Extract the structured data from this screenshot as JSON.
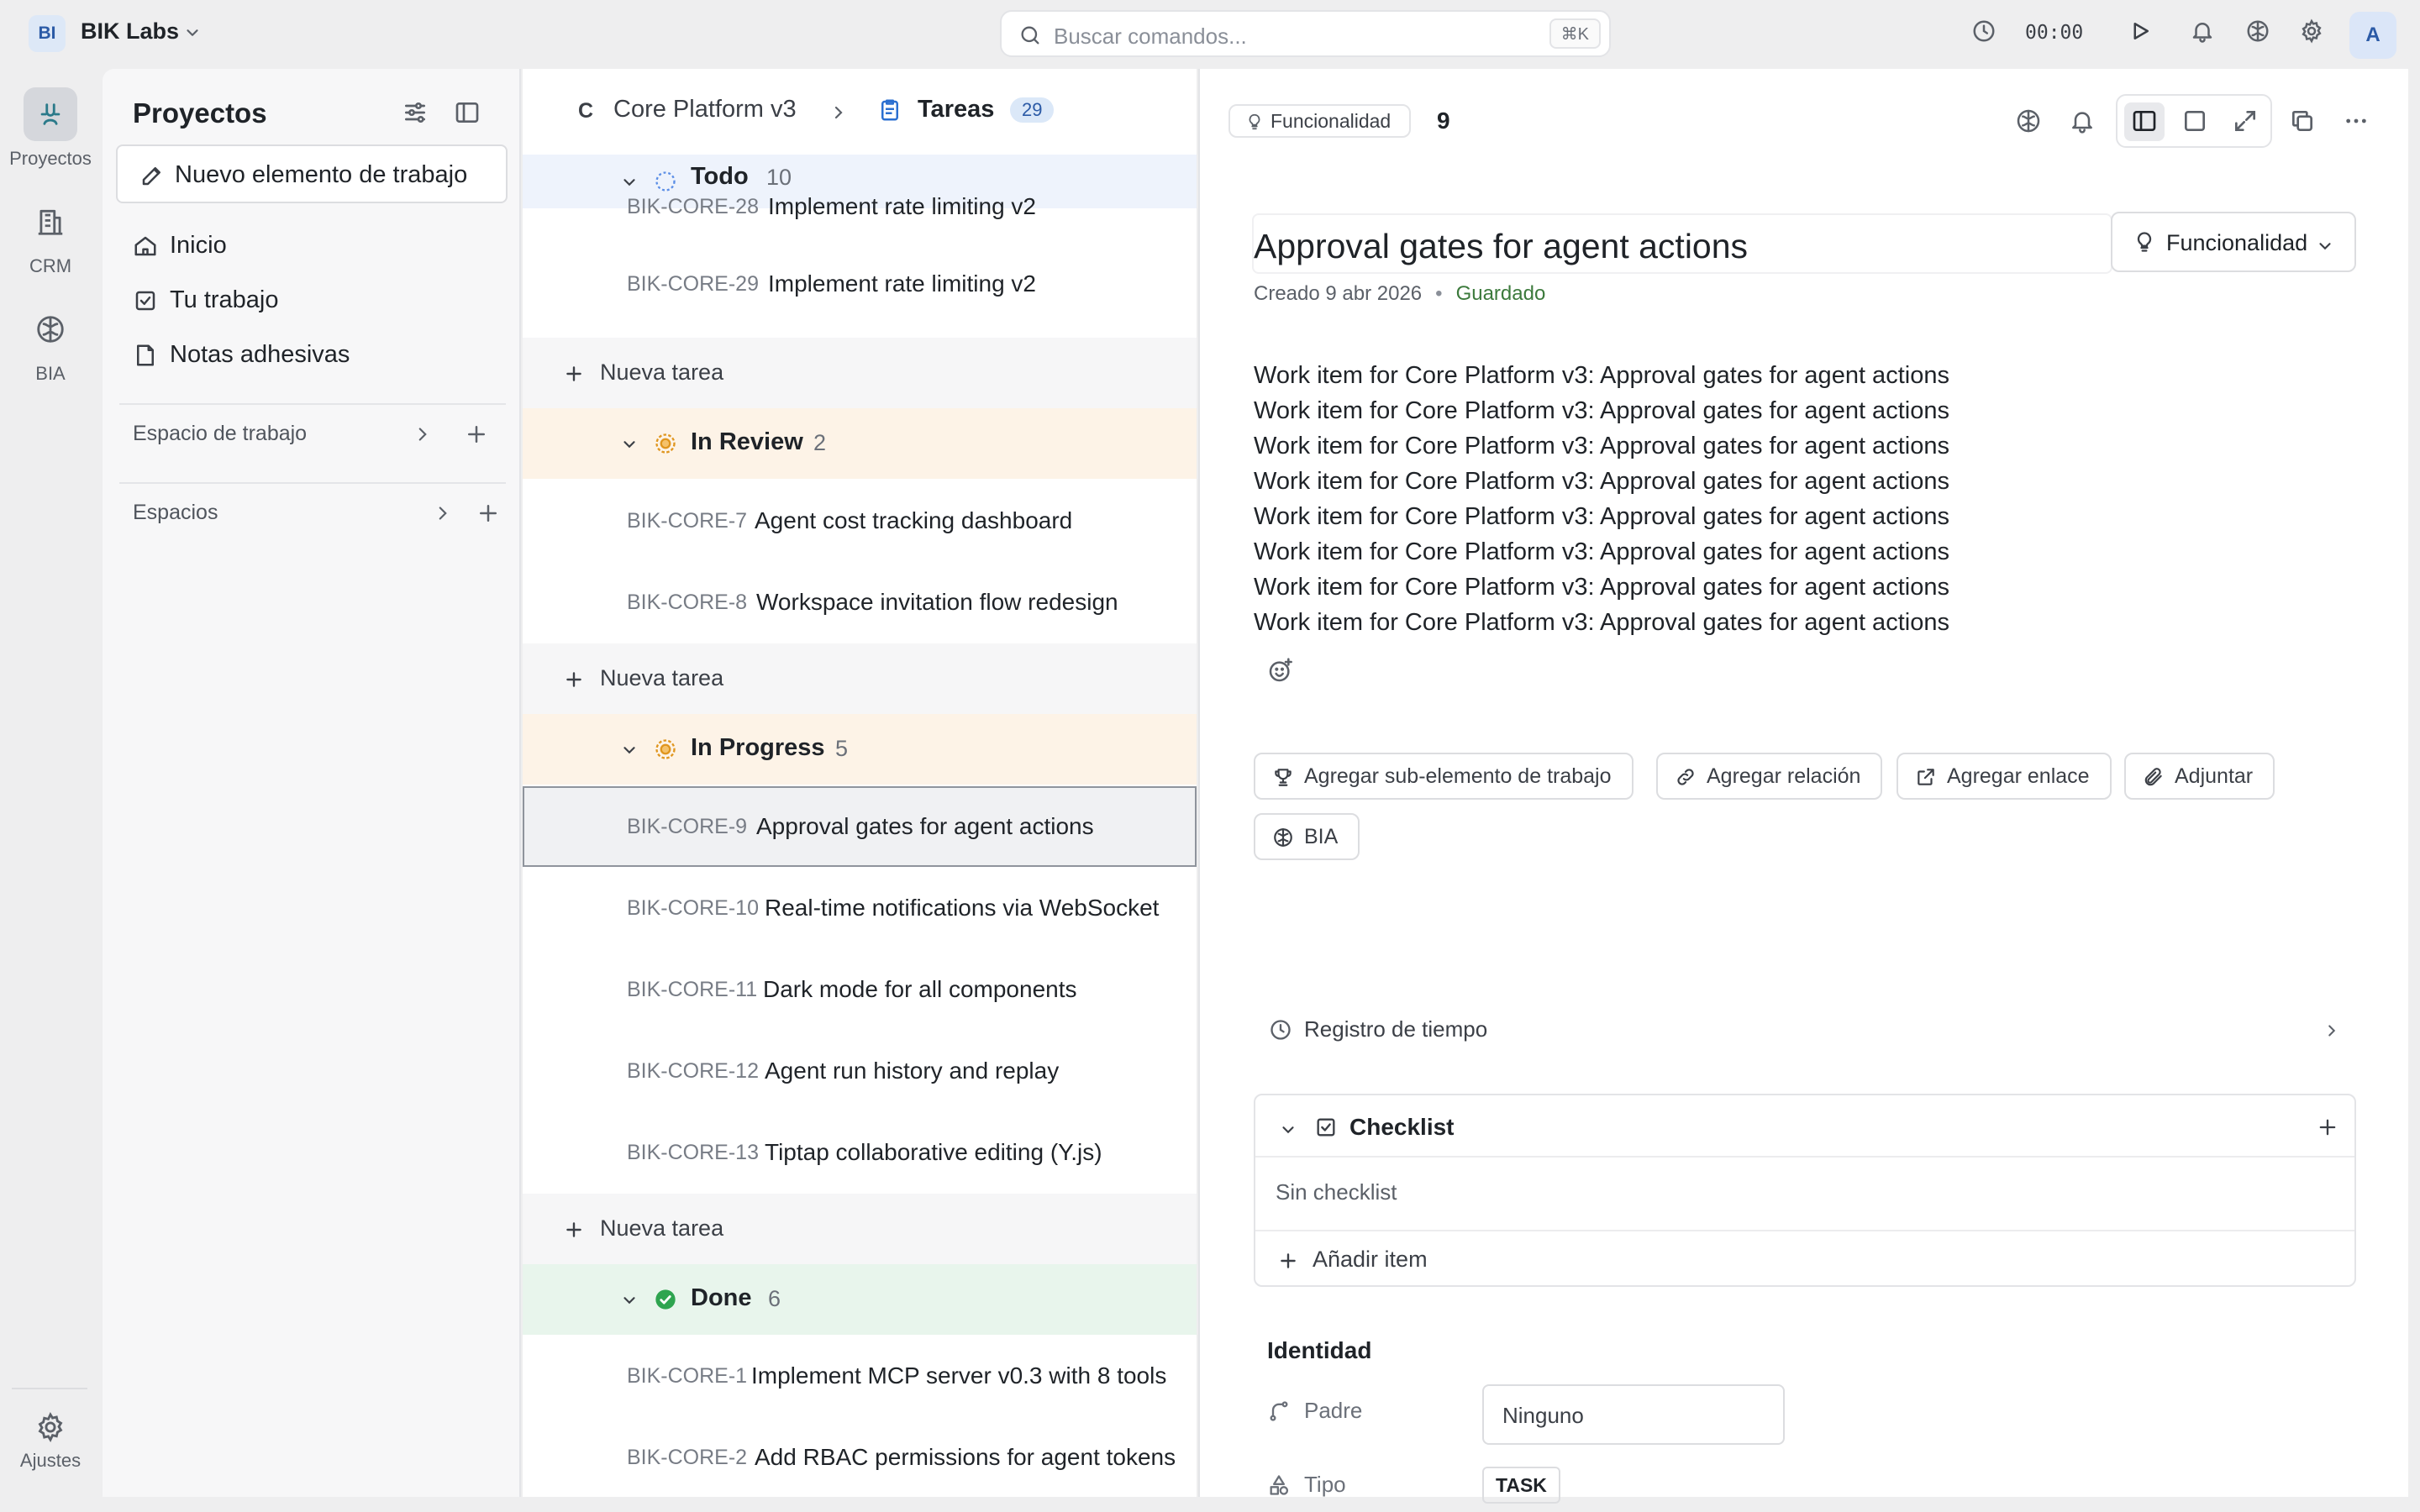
{
  "workspace": {
    "badge": "BI",
    "name": "BIK Labs"
  },
  "search": {
    "placeholder": "Buscar comandos...",
    "shortcut": "⌘K"
  },
  "timer": "00:00",
  "user": {
    "avatar": "A"
  },
  "rail": {
    "items": [
      {
        "label": "Proyectos",
        "icon": "projects-icon",
        "active": true
      },
      {
        "label": "CRM",
        "icon": "building-icon",
        "active": false
      },
      {
        "label": "BIA",
        "icon": "brain-icon",
        "active": false
      }
    ],
    "settings_label": "Ajustes"
  },
  "projects_panel": {
    "title": "Proyectos",
    "new_item": "Nuevo elemento de trabajo",
    "nav": [
      {
        "label": "Inicio",
        "icon": "home-icon"
      },
      {
        "label": "Tu trabajo",
        "icon": "check-square-icon"
      },
      {
        "label": "Notas adhesivas",
        "icon": "note-icon"
      }
    ],
    "sections": [
      "Espacio de trabajo",
      "Espacios"
    ]
  },
  "tasks_panel": {
    "breadcrumb": {
      "project_initial": "C",
      "project": "Core Platform v3",
      "view": "Tareas",
      "count": "29"
    },
    "new_task_label": "Nueva tarea",
    "groups": [
      {
        "name": "Todo",
        "count": "10",
        "status": "todo",
        "tasks": [
          {
            "id": "BIK-CORE-28",
            "title": "Implement rate limiting v2"
          },
          {
            "id": "BIK-CORE-29",
            "title": "Implement rate limiting v2"
          }
        ]
      },
      {
        "name": "In Review",
        "count": "2",
        "status": "review",
        "tasks": [
          {
            "id": "BIK-CORE-7",
            "title": "Agent cost tracking dashboard"
          },
          {
            "id": "BIK-CORE-8",
            "title": "Workspace invitation flow redesign"
          }
        ]
      },
      {
        "name": "In Progress",
        "count": "5",
        "status": "progress",
        "tasks": [
          {
            "id": "BIK-CORE-9",
            "title": "Approval gates for agent actions",
            "selected": true
          },
          {
            "id": "BIK-CORE-10",
            "title": "Real-time notifications via WebSocket"
          },
          {
            "id": "BIK-CORE-11",
            "title": "Dark mode for all components"
          },
          {
            "id": "BIK-CORE-12",
            "title": "Agent run history and replay"
          },
          {
            "id": "BIK-CORE-13",
            "title": "Tiptap collaborative editing (Y.js)"
          }
        ]
      },
      {
        "name": "Done",
        "count": "6",
        "status": "done",
        "tasks": [
          {
            "id": "BIK-CORE-1",
            "title": "Implement MCP server v0.3 with 8 tools"
          },
          {
            "id": "BIK-CORE-2",
            "title": "Add RBAC permissions for agent tokens"
          }
        ]
      }
    ]
  },
  "detail": {
    "type_label": "Funcionalidad",
    "number": "9",
    "title": "Approval gates for agent actions",
    "type_dropdown": "Funcionalidad",
    "created": "Creado 9 abr 2026",
    "saved": "Guardado",
    "description_lines": [
      "Work item for Core Platform v3: Approval gates for agent actions",
      "Work item for Core Platform v3: Approval gates for agent actions",
      "Work item for Core Platform v3: Approval gates for agent actions",
      "Work item for Core Platform v3: Approval gates for agent actions",
      "Work item for Core Platform v3: Approval gates for agent actions",
      "Work item for Core Platform v3: Approval gates for agent actions",
      "Work item for Core Platform v3: Approval gates for agent actions",
      "Work item for Core Platform v3: Approval gates for agent actions"
    ],
    "actions": {
      "add_subitem": "Agregar sub-elemento de trabajo",
      "add_relation": "Agregar relación",
      "add_link": "Agregar enlace",
      "attach": "Adjuntar",
      "bia": "BIA"
    },
    "time_log": "Registro de tiempo",
    "checklist": {
      "title": "Checklist",
      "empty": "Sin checklist",
      "add_item": "Añadir item"
    },
    "identity": {
      "title": "Identidad",
      "parent_label": "Padre",
      "parent_value": "Ninguno",
      "type_label": "Tipo",
      "type_value": "TASK"
    }
  },
  "colors": {
    "accent": "#2b5aa6",
    "todo_bg": "#eef3fc",
    "review_bg": "#fdf3e7",
    "progress_bg": "#fdf3e7",
    "done_bg": "#e8f5ec",
    "saved_green": "#3c7a3c"
  }
}
